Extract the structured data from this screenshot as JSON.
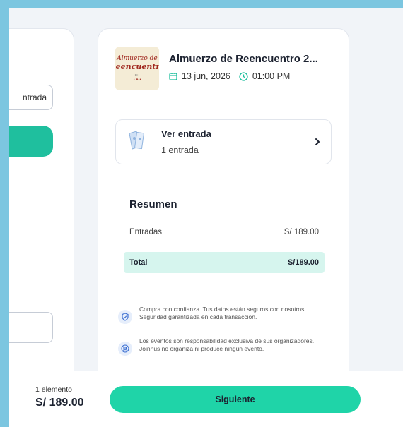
{
  "left_panel": {
    "outline_button_label": "ntrada"
  },
  "event": {
    "title": "Almuerzo de Reencuentro 2...",
    "date": "13 jun, 2026",
    "time": "01:00 PM",
    "thumb_lines": [
      "Almuerzo de",
      "Reencuentro",
      "• • •",
      "• ✦ •"
    ]
  },
  "ticket": {
    "label": "Ver entrada",
    "count": "1 entrada"
  },
  "summary": {
    "title": "Resumen",
    "entradas_label": "Entradas",
    "entradas_value": "S/ 189.00",
    "total_label": "Total",
    "total_value": "S/189.00"
  },
  "notes": [
    "Compra con confianza. Tus datos están seguros con nosotros. Seguridad garantizada en cada transacción.",
    "Los eventos son responsabilidad exclusiva de sus organizadores. Joinnus no organiza ni produce ningún evento."
  ],
  "footer": {
    "items_count": "1 elemento",
    "total": "S/ 189.00",
    "next_label": "Siguiente"
  },
  "colors": {
    "accent": "#1fd4a8",
    "accent_dark": "#1fbf9e",
    "total_bg": "#d6f5ee"
  }
}
